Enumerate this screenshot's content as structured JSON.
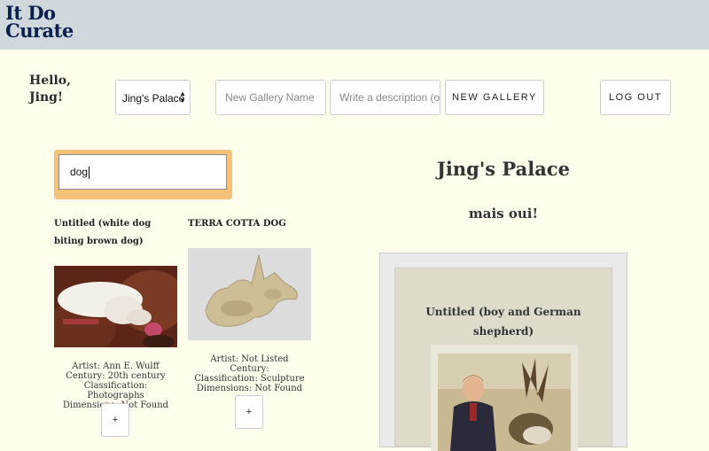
{
  "app": {
    "logo_line1": "It Do",
    "logo_line2": "Curate"
  },
  "header": {
    "greeting": "Hello, Jing!",
    "gallery_select": "Jing's Palace",
    "name_placeholder": "New Gallery Name",
    "desc_placeholder": "Write a description (o",
    "new_gallery_label": "New Gallery",
    "logout_label": "Log Out"
  },
  "search": {
    "value": "dog"
  },
  "results": [
    {
      "title": "Untitled (white dog biting brown dog)",
      "artist": "Artist: Ann E. Wulff",
      "century": "Century: 20th century",
      "classification": "Classification: Photographs",
      "dimensions": "Dimensions: Not Found",
      "add_label": "+"
    },
    {
      "title": "TERRA COTTA DOG",
      "artist": "Artist: Not Listed",
      "century": "Century:",
      "classification": "Classification: Sculpture",
      "dimensions": "Dimensions: Not Found",
      "add_label": "+"
    }
  ],
  "gallery": {
    "title": "Jing's Palace",
    "description": "mais oui!",
    "featured_title": "Untitled (boy and German shepherd)"
  },
  "colors": {
    "topbar": "#cfd9dd",
    "background": "#fffdec",
    "search_highlight": "#f5c078",
    "logo": "#0b1f4d"
  }
}
